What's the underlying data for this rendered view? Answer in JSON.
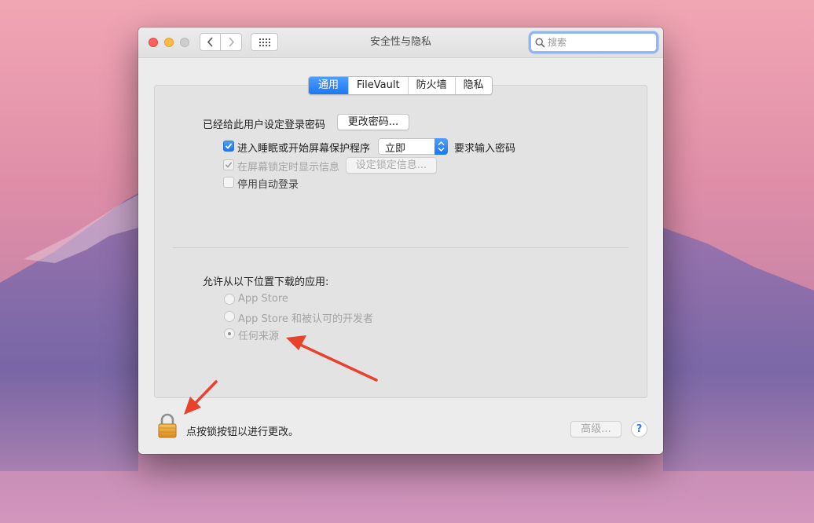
{
  "window": {
    "title": "安全性与隐私",
    "search_placeholder": "搜索"
  },
  "tabs": [
    {
      "label": "通用",
      "active": true
    },
    {
      "label": "FileVault",
      "active": false
    },
    {
      "label": "防火墙",
      "active": false
    },
    {
      "label": "隐私",
      "active": false
    }
  ],
  "general": {
    "password_label": "已经给此用户设定登录密码",
    "change_password_button": "更改密码...",
    "require_password": {
      "label": "进入睡眠或开始屏幕保护程序",
      "checked": true,
      "delay_value": "立即",
      "suffix": "要求输入密码"
    },
    "show_message": {
      "label": "在屏幕锁定时显示信息",
      "checked": true,
      "enabled": false,
      "button": "设定锁定信息..."
    },
    "disable_auto_login": {
      "label": "停用自动登录",
      "checked": false
    }
  },
  "downloads": {
    "heading": "允许从以下位置下载的应用:",
    "options": [
      {
        "label": "App Store",
        "selected": false
      },
      {
        "label": "App Store 和被认可的开发者",
        "selected": false
      },
      {
        "label": "任何来源",
        "selected": true
      }
    ]
  },
  "footer": {
    "lock_text": "点按锁按钮以进行更改。",
    "advanced_button": "高级...",
    "help_label": "?"
  },
  "colors": {
    "accent": "#1c78f2",
    "annotation_arrow": "#e8412c"
  }
}
